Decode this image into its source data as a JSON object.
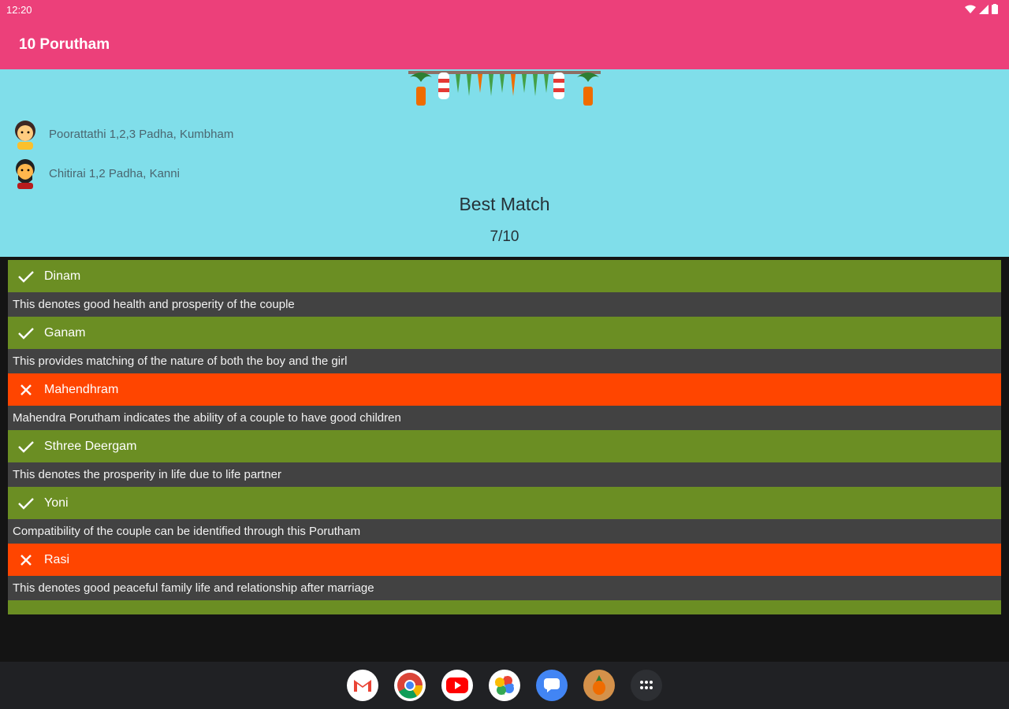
{
  "status_bar": {
    "time": "12:20",
    "icons": [
      "wifi-icon",
      "signal-icon",
      "battery-icon"
    ]
  },
  "app_bar": {
    "title": "10 Porutham"
  },
  "profiles": [
    {
      "label": "Poorattathi 1,2,3 Padha, Kumbham",
      "icon": "bride-avatar-icon"
    },
    {
      "label": "Chitirai 1,2 Padha, Kanni",
      "icon": "groom-avatar-icon"
    }
  ],
  "result": {
    "title": "Best Match",
    "score": "7/10"
  },
  "poruthams": [
    {
      "name": "Dinam",
      "status": "match",
      "description": "This denotes good health and prosperity of the couple"
    },
    {
      "name": "Ganam",
      "status": "match",
      "description": "This provides matching of the nature of both the boy and the girl"
    },
    {
      "name": "Mahendhram",
      "status": "no-match",
      "description": "Mahendra Porutham indicates the ability of a couple to have good children"
    },
    {
      "name": "Sthree Deergam",
      "status": "match",
      "description": "This denotes the prosperity in life due to life partner"
    },
    {
      "name": "Yoni",
      "status": "match",
      "description": "Compatibility of the couple can be identified through this Porutham"
    },
    {
      "name": "Rasi",
      "status": "no-match",
      "description": "This denotes good peaceful family life and relationship after marriage"
    }
  ],
  "colors": {
    "app_bar": "#ec407a",
    "header": "#80deea",
    "match": "#6b8e23",
    "no_match": "#ff4500",
    "description": "#424242"
  },
  "dock": [
    "gmail-icon",
    "chrome-icon",
    "youtube-icon",
    "photos-icon",
    "messages-icon",
    "porutham-app-icon",
    "app-drawer-icon"
  ]
}
